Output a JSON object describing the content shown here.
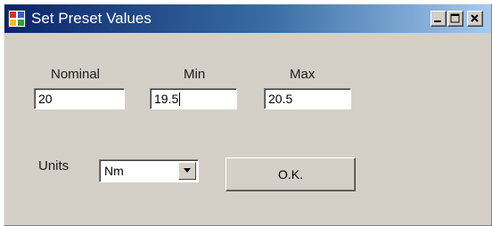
{
  "window": {
    "title": "Set Preset Values",
    "title_color": "#ffffff",
    "titlebar_gradient": [
      "#0a246a",
      "#3a6ea5",
      "#a6caf0"
    ]
  },
  "title_buttons": {
    "minimize_icon": "minimize-icon",
    "maximize_icon": "maximize-icon",
    "close_icon": "close-icon"
  },
  "fields": {
    "nominal": {
      "label": "Nominal",
      "value": "20"
    },
    "min": {
      "label": "Min",
      "value": "19.5"
    },
    "max": {
      "label": "Max",
      "value": "20.5"
    }
  },
  "units": {
    "label": "Units",
    "selected": "Nm"
  },
  "actions": {
    "ok_label": "O.K."
  }
}
